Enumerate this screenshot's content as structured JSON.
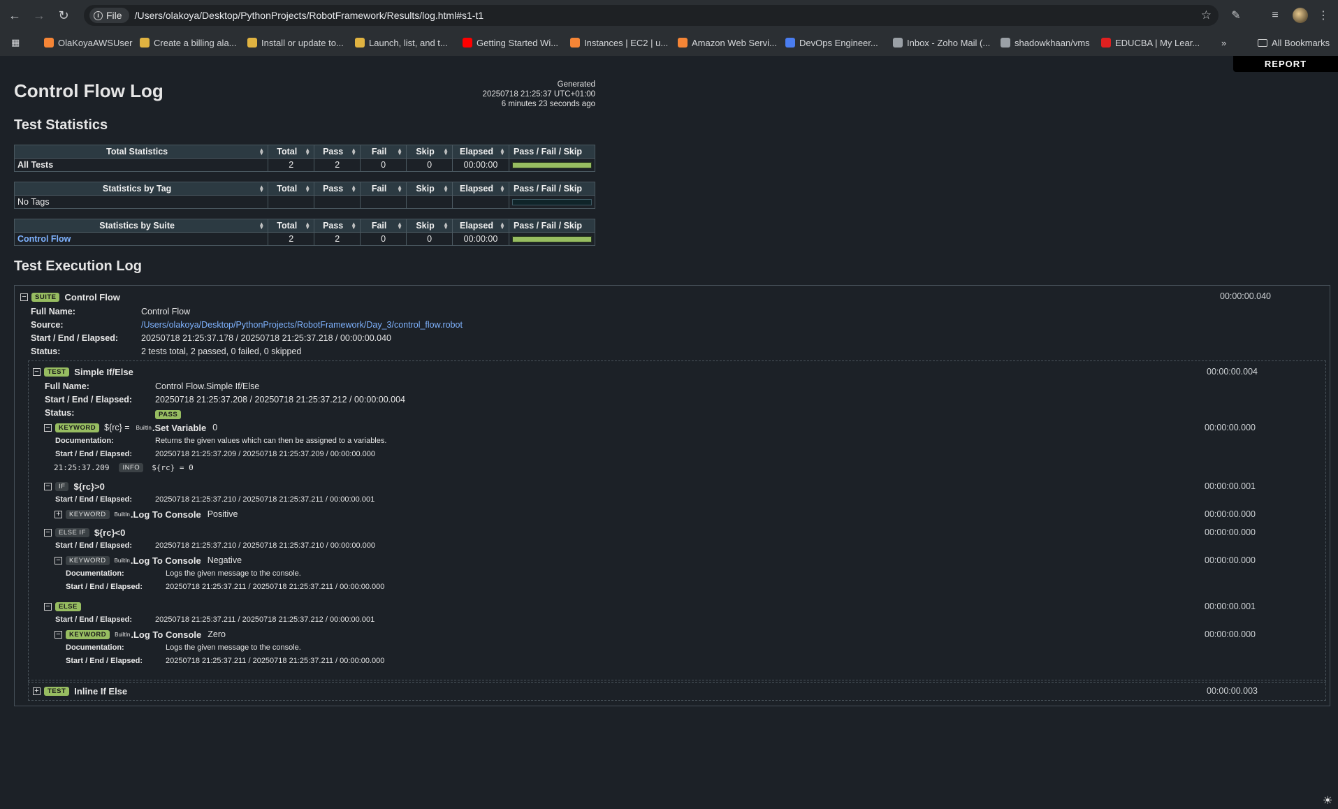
{
  "browser": {
    "url_chip": "File",
    "url": "/Users/olakoya/Desktop/PythonProjects/RobotFramework/Results/log.html#s1-t1",
    "bookmarks": [
      {
        "label": "OlaKoyaAWSUser",
        "color": "#f58536"
      },
      {
        "label": "Create a billing ala...",
        "color": "#e0b341"
      },
      {
        "label": "Install or update to...",
        "color": "#e0b341"
      },
      {
        "label": "Launch, list, and t...",
        "color": "#e0b341"
      },
      {
        "label": "Getting Started Wi...",
        "color": "#ff0000"
      },
      {
        "label": "Instances | EC2 | u...",
        "color": "#f58536"
      },
      {
        "label": "Amazon Web Servi...",
        "color": "#f58536"
      },
      {
        "label": "DevOps Engineer...",
        "color": "#4a7df0"
      },
      {
        "label": "Inbox - Zoho Mail (...",
        "color": "#9aa0a6"
      },
      {
        "label": "shadowkhaan/vms",
        "color": "#9aa0a6"
      },
      {
        "label": "EDUCBA | My Lear...",
        "color": "#e02020"
      }
    ],
    "all_bookmarks": "All Bookmarks"
  },
  "report_button": "REPORT",
  "page_title": "Control Flow Log",
  "generated": {
    "label": "Generated",
    "timestamp": "20250718 21:25:37 UTC+01:00",
    "ago": "6 minutes 23 seconds ago"
  },
  "test_statistics": {
    "heading": "Test Statistics",
    "columns": [
      "Total",
      "Pass",
      "Fail",
      "Skip",
      "Elapsed",
      "Pass / Fail / Skip"
    ],
    "total": {
      "header": "Total Statistics",
      "rows": [
        {
          "name": "All Tests",
          "total": "2",
          "pass": "2",
          "fail": "0",
          "skip": "0",
          "elapsed": "00:00:00",
          "pass_fraction": 1.0
        }
      ]
    },
    "tag": {
      "header": "Statistics by Tag",
      "rows": [
        {
          "name": "No Tags",
          "total": "",
          "pass": "",
          "fail": "",
          "skip": "",
          "elapsed": "",
          "pass_fraction": 0
        }
      ]
    },
    "suite": {
      "header": "Statistics by Suite",
      "rows": [
        {
          "name": "Control Flow",
          "total": "2",
          "pass": "2",
          "fail": "0",
          "skip": "0",
          "elapsed": "00:00:00",
          "pass_fraction": 1.0
        }
      ]
    }
  },
  "execution_log": {
    "heading": "Test Execution Log",
    "suite": {
      "badge": "SUITE",
      "name": "Control Flow",
      "elapsed": "00:00:00.040",
      "full_name_label": "Full Name:",
      "full_name": "Control Flow",
      "source_label": "Source:",
      "source": "/Users/olakoya/Desktop/PythonProjects/RobotFramework/Day_3/control_flow.robot",
      "times_label": "Start / End / Elapsed:",
      "times": "20250718 21:25:37.178 / 20250718 21:25:37.218 / 00:00:00.040",
      "status_label": "Status:",
      "status": "2 tests total, 2 passed, 0 failed, 0 skipped"
    },
    "test1": {
      "badge": "TEST",
      "name": "Simple If/Else",
      "elapsed": "00:00:00.004",
      "full_name_label": "Full Name:",
      "full_name": "Control Flow.Simple If/Else",
      "times_label": "Start / End / Elapsed:",
      "times": "20250718 21:25:37.208 / 20250718 21:25:37.212 / 00:00:00.004",
      "status_label": "Status:",
      "status": "PASS"
    },
    "kw_set": {
      "badge": "KEYWORD",
      "assign": "${rc} =",
      "lib": "BuiltIn",
      "name": "Set Variable",
      "arg": "0",
      "elapsed": "00:00:00.000",
      "doc_label": "Documentation:",
      "doc": "Returns the given values which can then be assigned to a variables.",
      "times_label": "Start / End / Elapsed:",
      "times": "20250718 21:25:37.209 / 20250718 21:25:37.209 / 00:00:00.000",
      "msg_time": "21:25:37.209",
      "msg_level": "INFO",
      "msg": "${rc} = 0"
    },
    "if_block": {
      "badge": "IF",
      "condition": "${rc}>0",
      "elapsed": "00:00:00.001",
      "times_label": "Start / End / Elapsed:",
      "times": "20250718 21:25:37.210 / 20250718 21:25:37.211 / 00:00:00.001",
      "kw_badge": "KEYWORD",
      "kw_lib": "BuiltIn",
      "kw_name": "Log To Console",
      "kw_arg": "Positive",
      "kw_elapsed": "00:00:00.000"
    },
    "elseif_block": {
      "badge": "ELSE IF",
      "condition": "${rc}<0",
      "elapsed": "00:00:00.000",
      "times_label": "Start / End / Elapsed:",
      "times": "20250718 21:25:37.210 / 20250718 21:25:37.210 / 00:00:00.000",
      "kw_badge": "KEYWORD",
      "kw_lib": "BuiltIn",
      "kw_name": "Log To Console",
      "kw_arg": "Negative",
      "kw_elapsed": "00:00:00.000",
      "kw_doc_label": "Documentation:",
      "kw_doc": "Logs the given message to the console.",
      "kw_times_label": "Start / End / Elapsed:",
      "kw_times": "20250718 21:25:37.211 / 20250718 21:25:37.211 / 00:00:00.000"
    },
    "else_block": {
      "badge": "ELSE",
      "elapsed": "00:00:00.001",
      "times_label": "Start / End / Elapsed:",
      "times": "20250718 21:25:37.211 / 20250718 21:25:37.212 / 00:00:00.001",
      "kw_badge": "KEYWORD",
      "kw_lib": "BuiltIn",
      "kw_name": "Log To Console",
      "kw_arg": "Zero",
      "kw_elapsed": "00:00:00.000",
      "kw_doc_label": "Documentation:",
      "kw_doc": "Logs the given message to the console.",
      "kw_times_label": "Start / End / Elapsed:",
      "kw_times": "20250718 21:25:37.211 / 20250718 21:25:37.211 / 00:00:00.000"
    },
    "test2": {
      "badge": "TEST",
      "name": "Inline If Else",
      "elapsed": "00:00:00.003"
    }
  },
  "colors": {
    "pass_green": "#97bd61",
    "link_blue": "#7fb3ff",
    "background": "#1c2127"
  }
}
